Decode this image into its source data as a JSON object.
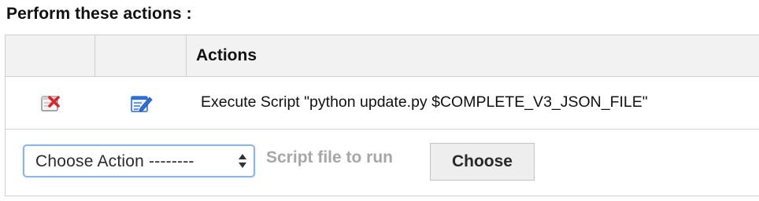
{
  "page": {
    "title": "Perform these actions :"
  },
  "table": {
    "headers": [
      "",
      "",
      "Actions"
    ],
    "rows": [
      {
        "delete_icon": "delete-document-icon",
        "edit_icon": "edit-document-icon",
        "action": "Execute Script \"python update.py $COMPLETE_V3_JSON_FILE\""
      }
    ]
  },
  "controls": {
    "select_value": "Choose Action --------",
    "script_label": "Script file to run",
    "choose_button": "Choose"
  },
  "colors": {
    "delete_red": "#d9262b",
    "edit_blue": "#2e6fd8",
    "focus_border": "#8fb4e8",
    "header_bg": "#f2f2f2"
  }
}
